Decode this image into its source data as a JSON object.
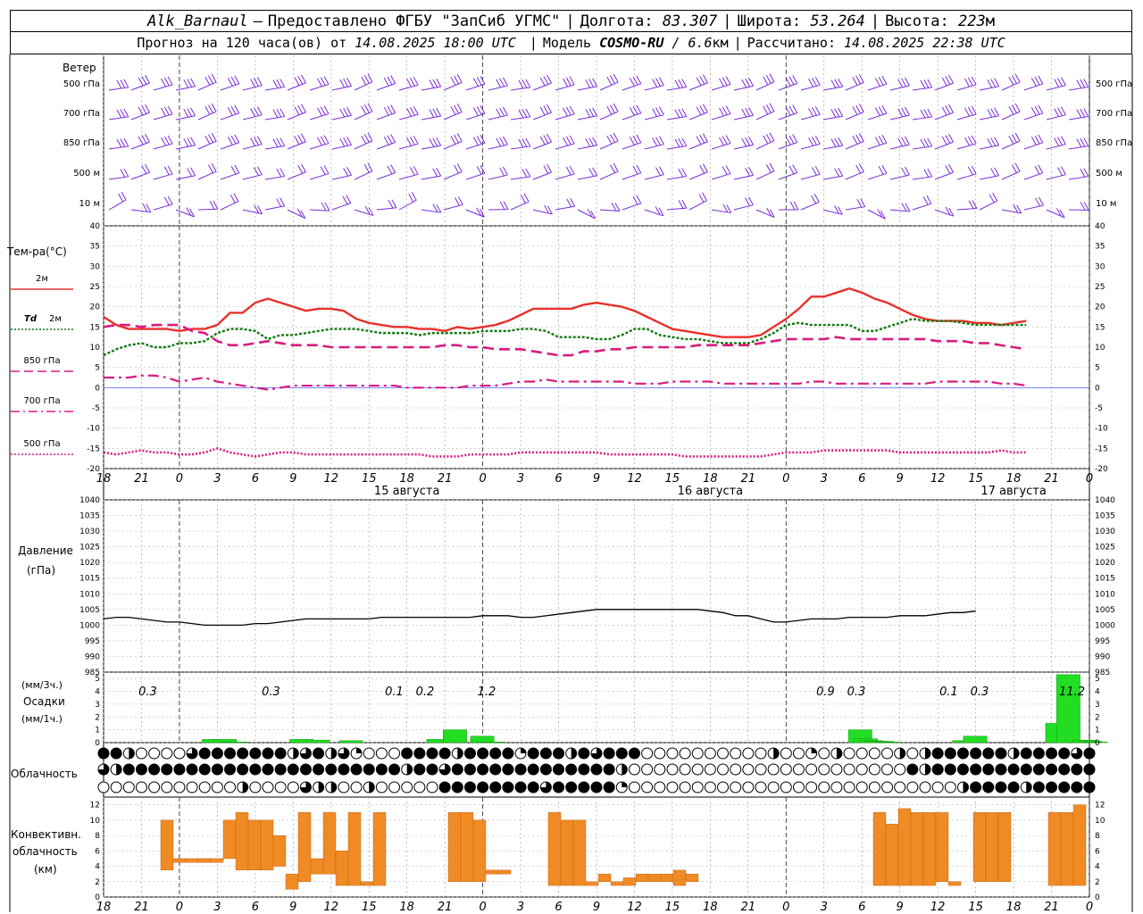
{
  "header": {
    "station": "Alk_Barnaul",
    "dash": "—",
    "provider": "Предоставлено ФГБУ \"ЗапСиб УГМС\"",
    "lon_label": "Долгота:",
    "lon_value": "83.307",
    "lat_label": "Широта:",
    "lat_value": "53.264",
    "alt_label": "Высота:",
    "alt_value": "223",
    "alt_unit": "м"
  },
  "subheader": {
    "forecast_label": "Прогноз на 120 часа(ов) от",
    "forecast_start": "14.08.2025 18:00 UTC",
    "model_label": "Модель",
    "model_name": "COSMO-RU",
    "model_res": "/ 6.6",
    "model_res_unit": "км",
    "calc_label": "Рассчитано:",
    "calc_time": "14.08.2025 22:38 UTC"
  },
  "time_axis": {
    "hour_labels": [
      "18",
      "21",
      "0",
      "3",
      "6",
      "9",
      "12",
      "15",
      "18",
      "21",
      "0",
      "3",
      "6",
      "9",
      "12",
      "15",
      "18",
      "21",
      "0",
      "3",
      "6",
      "9",
      "12",
      "15",
      "18",
      "21",
      "0"
    ],
    "date_labels": [
      {
        "hour_index": 8,
        "text": "15 августа"
      },
      {
        "hour_index": 16,
        "text": "16 августа"
      },
      {
        "hour_index": 24,
        "text": "17 августа"
      }
    ]
  },
  "wind_panel": {
    "title": "Ветер",
    "levels": [
      "500 гПа",
      "700 гПа",
      "850 гПа",
      "500 м",
      "10  м"
    ],
    "color": "#7b2cd6"
  },
  "temp_panel": {
    "title": "Тем-ра(°C)",
    "legend": [
      {
        "label": "2м",
        "italic_prefix": "",
        "color": "#e8302a",
        "style": "solid"
      },
      {
        "label": "2м",
        "italic_prefix": "Td",
        "color": "#127812",
        "style": "dotted"
      },
      {
        "label": "850 гПа",
        "italic_prefix": "",
        "color": "#d81b82",
        "style": "dashed"
      },
      {
        "label": "700 гПа",
        "italic_prefix": "",
        "color": "#d81b82",
        "style": "dashdot"
      },
      {
        "label": "500 гПа",
        "italic_prefix": "",
        "color": "#d81b82",
        "style": "dotted"
      }
    ],
    "ticks": [
      "40",
      "35",
      "30",
      "25",
      "20",
      "15",
      "10",
      "5",
      "0",
      "-5",
      "-10",
      "-15",
      "-20"
    ]
  },
  "pressure_panel": {
    "title_line1": "Давление",
    "title_line2": "(гПа)",
    "ticks": [
      "1040",
      "1035",
      "1030",
      "1025",
      "1020",
      "1015",
      "1010",
      "1005",
      "1000",
      "995",
      "990",
      "985"
    ]
  },
  "precip_panel": {
    "unit_top": "(мм/3ч.)",
    "title": "Осадки",
    "unit_bottom": "(мм/1ч.)",
    "ticks": [
      "5",
      "4",
      "3",
      "2",
      "1",
      "0"
    ],
    "totals": [
      {
        "hour_index": 1,
        "text": "0.3"
      },
      {
        "hour_index": 5,
        "text": "0.3"
      },
      {
        "hour_index": 9,
        "text": "0.1"
      },
      {
        "hour_index": 10,
        "text": "0.2"
      },
      {
        "hour_index": 12,
        "text": "1.2"
      },
      {
        "hour_index": 23,
        "text": "0.9"
      },
      {
        "hour_index": 24,
        "text": "0.3"
      },
      {
        "hour_index": 27,
        "text": "0.1"
      },
      {
        "hour_index": 28,
        "text": "0.3"
      },
      {
        "hour_index": 31,
        "text": "11.2"
      }
    ],
    "bar_color": "#22dd22"
  },
  "cloud_panel": {
    "title": "Облачность"
  },
  "conv_panel": {
    "title_line1": "Конвективн.",
    "title_line2": "облачность",
    "title_line3": "(км)",
    "ticks": [
      "12",
      "10",
      "8",
      "6",
      "4",
      "2",
      "0"
    ],
    "bar_color": "#f08a24"
  },
  "chart_data": [
    {
      "type": "line",
      "panel": "temperature",
      "ylabel": "Тем-ра(°C)",
      "ylim": [
        -20,
        40
      ],
      "x_hours": [
        0,
        3,
        6,
        9,
        12,
        15,
        18,
        21,
        24,
        27,
        30,
        33,
        36,
        39,
        42,
        45,
        48,
        51,
        54,
        57,
        60,
        63,
        66,
        69,
        72,
        75,
        78,
        81,
        84,
        87,
        90,
        93,
        96,
        99,
        102,
        105,
        108,
        111,
        114,
        117,
        120,
        123,
        126,
        129,
        132,
        135,
        138,
        141,
        144,
        147,
        150,
        153,
        156,
        159,
        162,
        165,
        168,
        171,
        174,
        177,
        180,
        183,
        186,
        189,
        192,
        195,
        198,
        201,
        204,
        207,
        210,
        213,
        216,
        219,
        222,
        225,
        228,
        231,
        234
      ],
      "series": [
        {
          "name": "2м",
          "values": [
            17.5,
            15.5,
            14.5,
            14.5,
            14.5,
            14.5,
            14,
            14.5,
            14.5,
            15.5,
            18.5,
            18.5,
            21,
            22,
            21,
            20,
            19,
            19.5,
            19.5,
            19,
            17,
            16,
            15.5,
            15,
            15,
            14.5,
            14.5,
            14,
            15,
            14.5,
            15,
            15.5,
            16.5,
            18,
            19.5,
            19.5,
            19.5,
            19.5,
            20.5,
            21,
            20.5,
            20,
            19,
            17.5,
            16,
            14.5,
            14,
            13.5,
            13,
            12.5,
            12.5,
            12.5,
            13,
            15,
            17,
            19.5,
            22.5,
            22.5,
            23.5,
            24.5,
            23.5,
            22,
            21,
            19.5,
            18,
            17,
            16.5,
            16.5,
            16.5,
            16,
            16,
            15.5,
            16,
            16.5
          ]
        },
        {
          "name": "Td 2м",
          "values": [
            8,
            9.5,
            10.5,
            11,
            10,
            10,
            11,
            11,
            11.5,
            13.5,
            14.5,
            14.5,
            14,
            12,
            13,
            13,
            13.5,
            14,
            14.5,
            14.5,
            14.5,
            14,
            13.5,
            13.5,
            13.5,
            13,
            13.5,
            13.5,
            13.5,
            13.5,
            14,
            14,
            14,
            14.5,
            14.5,
            14,
            12.5,
            12.5,
            12.5,
            12,
            12,
            13,
            14.5,
            14.5,
            13,
            12.5,
            12,
            12,
            11.5,
            11,
            11,
            11,
            12,
            13.5,
            15.5,
            16,
            15.5,
            15.5,
            15.5,
            15.5,
            14,
            14,
            15,
            16,
            17,
            16.5,
            16.5,
            16.5,
            16,
            15.5,
            15.5,
            15.5,
            15.5,
            15.5
          ]
        },
        {
          "name": "850 гПа",
          "values": [
            15,
            15.5,
            15.5,
            15,
            15.5,
            15.5,
            15.5,
            14,
            13.5,
            11.5,
            10.5,
            10.5,
            11,
            11.5,
            11,
            10.5,
            10.5,
            10.5,
            10,
            10,
            10,
            10,
            10,
            10,
            10,
            10,
            10,
            10.5,
            10.5,
            10,
            10,
            9.5,
            9.5,
            9.5,
            9,
            8.5,
            8,
            8,
            9,
            9,
            9.5,
            9.5,
            10,
            10,
            10,
            10,
            10,
            10.5,
            10.5,
            10.5,
            10.5,
            10.5,
            11,
            11.5,
            12,
            12,
            12,
            12,
            12.5,
            12,
            12,
            12,
            12,
            12,
            12,
            12,
            11.5,
            11.5,
            11.5,
            11,
            11,
            10.5,
            10,
            9.5
          ]
        },
        {
          "name": "700 гПа",
          "values": [
            2.5,
            2.5,
            2.5,
            3,
            3,
            2.5,
            1.5,
            2,
            2.5,
            1.5,
            1,
            0.5,
            0,
            -0.5,
            0,
            0.5,
            0.5,
            0.5,
            0.5,
            0.5,
            0.5,
            0.5,
            0.5,
            0.5,
            0,
            0,
            0,
            0,
            0,
            0.5,
            0.5,
            0.5,
            1,
            1.5,
            1.5,
            2,
            1.5,
            1.5,
            1.5,
            1.5,
            1.5,
            1.5,
            1,
            1,
            1,
            1.5,
            1.5,
            1.5,
            1.5,
            1,
            1,
            1,
            1,
            1,
            1,
            1,
            1.5,
            1.5,
            1,
            1,
            1,
            1,
            1,
            1,
            1,
            1,
            1.5,
            1.5,
            1.5,
            1.5,
            1.5,
            1,
            1,
            0.5
          ]
        },
        {
          "name": "500 гПа",
          "values": [
            -16,
            -16.5,
            -16,
            -15.5,
            -16,
            -16,
            -16.5,
            -16.5,
            -16,
            -15,
            -16,
            -16.5,
            -17,
            -16.5,
            -16,
            -16,
            -16.5,
            -16.5,
            -16.5,
            -16.5,
            -16.5,
            -16.5,
            -16.5,
            -16.5,
            -16.5,
            -16.5,
            -17,
            -17,
            -17,
            -16.5,
            -16.5,
            -16.5,
            -16.5,
            -16,
            -16,
            -16,
            -16,
            -16,
            -16,
            -16,
            -16.5,
            -16.5,
            -16.5,
            -16.5,
            -16.5,
            -16.5,
            -17,
            -17,
            -17,
            -17,
            -17,
            -17,
            -17,
            -16.5,
            -16,
            -16,
            -16,
            -15.5,
            -15.5,
            -15.5,
            -15.5,
            -15.5,
            -15.5,
            -16,
            -16,
            -16,
            -16,
            -16,
            -16,
            -16,
            -16,
            -15.5,
            -16,
            -16
          ]
        }
      ]
    },
    {
      "type": "line",
      "panel": "pressure",
      "ylabel": "Давление (гПа)",
      "ylim": [
        985,
        1040
      ],
      "x_hours": [
        0,
        3,
        6,
        9,
        12,
        15,
        18,
        21,
        24,
        27,
        30,
        33,
        36,
        39,
        42,
        45,
        48,
        51,
        54,
        57,
        60,
        63,
        66,
        69,
        72,
        75,
        78,
        81,
        84,
        87,
        90,
        93,
        96,
        99,
        102,
        105,
        108,
        111,
        114,
        117,
        120,
        123,
        126,
        129,
        132,
        135,
        138,
        141,
        144,
        147,
        150,
        153,
        156,
        159,
        162,
        165,
        168,
        171,
        174,
        177,
        180,
        183,
        186,
        189,
        192,
        195,
        198,
        201,
        204,
        207,
        210,
        213,
        216,
        219,
        222,
        225,
        228,
        231,
        234
      ],
      "series": [
        {
          "name": "Давление",
          "values": [
            1002,
            1002.5,
            1002.5,
            1002,
            1001.5,
            1001,
            1001,
            1000.5,
            1000,
            1000,
            1000,
            1000,
            1000.5,
            1000.5,
            1001,
            1001.5,
            1002,
            1002,
            1002,
            1002,
            1002,
            1002,
            1002.5,
            1002.5,
            1002.5,
            1002.5,
            1002.5,
            1002.5,
            1002.5,
            1002.5,
            1003,
            1003,
            1003,
            1002.5,
            1002.5,
            1003,
            1003.5,
            1004,
            1004.5,
            1005,
            1005,
            1005,
            1005,
            1005,
            1005,
            1005,
            1005,
            1005,
            1004.5,
            1004,
            1003,
            1003,
            1002,
            1001,
            1001,
            1001.5,
            1002,
            1002,
            1002,
            1002.5,
            1002.5,
            1002.5,
            1002.5,
            1003,
            1003,
            1003,
            1003.5,
            1004,
            1004,
            1004.5
          ]
        }
      ]
    },
    {
      "type": "bar",
      "panel": "precipitation",
      "ylabel": "мм/1ч.",
      "ylim": [
        0,
        5.5
      ],
      "x_hours": [
        18,
        20,
        21,
        22,
        34,
        37,
        43,
        59,
        62,
        67,
        68,
        69,
        136,
        137,
        138,
        139,
        140,
        141,
        155,
        157,
        172,
        174,
        177,
        178,
        179
      ],
      "values": [
        0.25,
        0.25,
        0.05,
        0.05,
        0.25,
        0.2,
        0.15,
        0.25,
        1.0,
        0.5,
        0.05,
        0.05,
        1.0,
        0.3,
        0.15,
        0.1,
        0.1,
        0.05,
        0.15,
        0.5,
        1.5,
        5.3,
        0.2,
        0.1,
        0.05
      ]
    },
    {
      "type": "bar",
      "panel": "convective_cloud",
      "ylabel": "Конвективн. облачность (км)",
      "ylim": [
        0,
        12
      ],
      "x_hours": [
        0,
        1,
        2,
        3,
        4,
        5,
        6,
        7,
        8,
        9,
        10,
        11,
        12,
        13,
        14,
        15,
        16,
        17,
        18,
        19,
        20,
        21,
        22,
        23,
        24,
        25,
        26,
        27,
        28,
        29,
        30,
        31,
        32,
        33,
        34,
        35
      ],
      "bars": [
        {
          "x": 3,
          "bottom": 3.5,
          "top": 10
        },
        {
          "x": 4,
          "bottom": 4.5,
          "top": 5
        },
        {
          "x": 5,
          "bottom": 4.5,
          "top": 5
        },
        {
          "x": 6,
          "bottom": 4.5,
          "top": 5
        },
        {
          "x": 7,
          "bottom": 4.5,
          "top": 5
        },
        {
          "x": 8,
          "bottom": 5,
          "top": 10
        },
        {
          "x": 9,
          "bottom": 3.5,
          "top": 11
        },
        {
          "x": 10,
          "bottom": 3.5,
          "top": 10
        },
        {
          "x": 11,
          "bottom": 3.5,
          "top": 10
        },
        {
          "x": 12,
          "bottom": 4,
          "top": 8
        },
        {
          "x": 13,
          "bottom": 1,
          "top": 3
        },
        {
          "x": 14,
          "bottom": 2,
          "top": 11
        },
        {
          "x": 15,
          "bottom": 3,
          "top": 5
        },
        {
          "x": 16,
          "bottom": 3,
          "top": 11
        },
        {
          "x": 17,
          "bottom": 1.5,
          "top": 6
        },
        {
          "x": 18,
          "bottom": 1.5,
          "top": 11
        },
        {
          "x": 19,
          "bottom": 1.5,
          "top": 2
        },
        {
          "x": 20,
          "bottom": 1.5,
          "top": 11
        }
      ]
    }
  ]
}
